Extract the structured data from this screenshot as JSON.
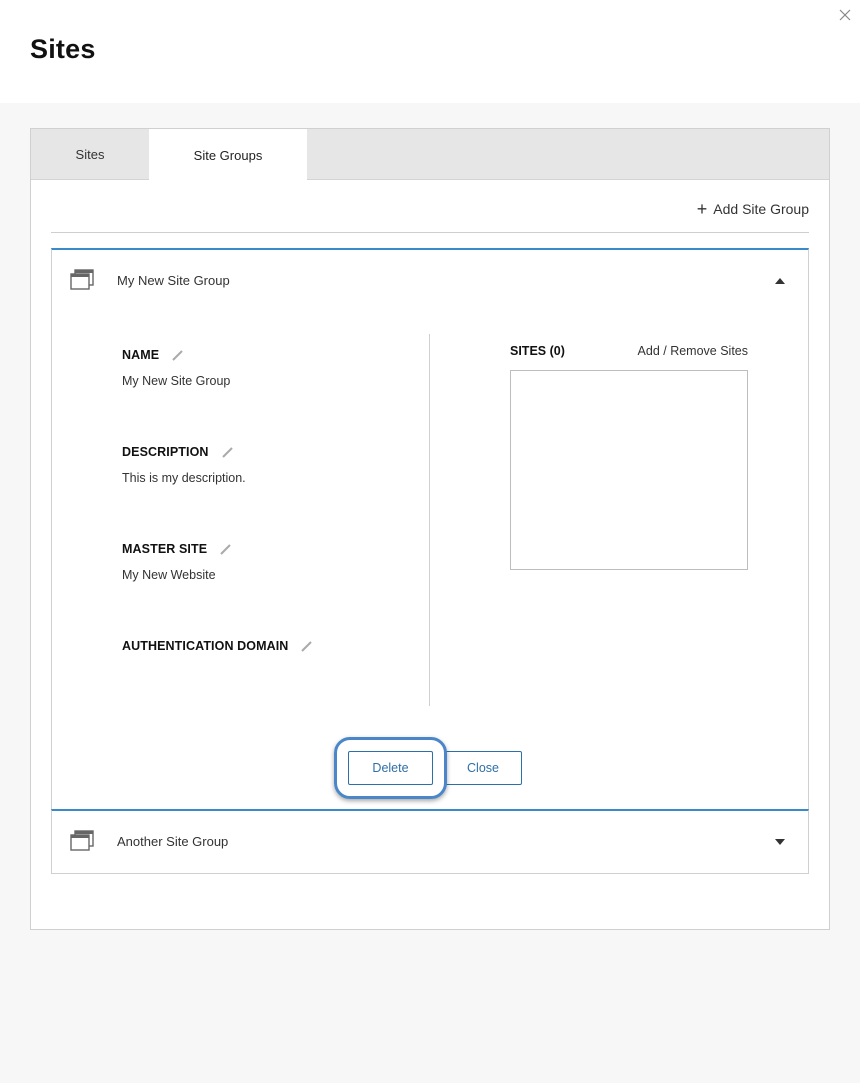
{
  "header": {
    "title": "Sites"
  },
  "tabs": [
    {
      "label": "Sites",
      "active": false
    },
    {
      "label": "Site Groups",
      "active": true
    }
  ],
  "toolbar": {
    "add_group_label": "Add Site Group"
  },
  "groups": [
    {
      "name": "My New Site Group",
      "expanded": true,
      "fields": [
        {
          "label": "NAME",
          "value": "My New Site Group"
        },
        {
          "label": "DESCRIPTION",
          "value": "This is my description."
        },
        {
          "label": "MASTER SITE",
          "value": "My New Website"
        },
        {
          "label": "AUTHENTICATION DOMAIN",
          "value": ""
        }
      ],
      "sites": {
        "title": "SITES (0)",
        "link": "Add / Remove Sites",
        "items": []
      },
      "actions": {
        "delete_label": "Delete",
        "close_label": "Close"
      }
    },
    {
      "name": "Another Site Group",
      "expanded": false
    }
  ],
  "colors": {
    "accent": "#3a8ac9",
    "button": "#2f6fa8",
    "highlight": "#4a86c8"
  }
}
